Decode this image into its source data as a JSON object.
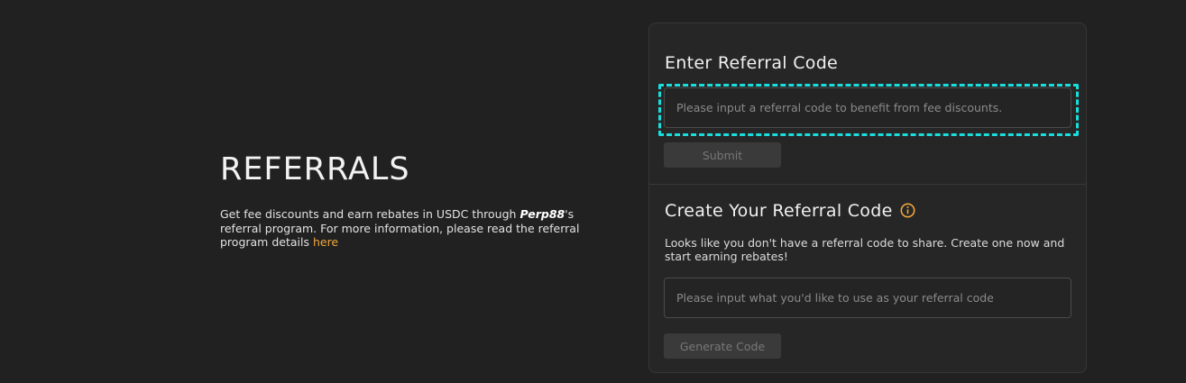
{
  "intro": {
    "title": "REFERRALS",
    "text_before": "Get fee discounts and earn rebates in USDC through ",
    "brand": "Perp88",
    "text_after": "'s referral program. For more information, please read the referral program details ",
    "link_label": "here"
  },
  "enter_section": {
    "title": "Enter Referral Code",
    "input_placeholder": "Please input a referral code to benefit from fee discounts.",
    "input_value": "",
    "submit_label": "Submit"
  },
  "create_section": {
    "title": "Create Your Referral Code",
    "info_icon": "info-circle-icon",
    "description": "Looks like you don't have a referral code to share. Create one now and start earning rebates!",
    "input_placeholder": "Please input what you'd like to use as your referral code",
    "input_value": "",
    "generate_label": "Generate Code"
  },
  "colors": {
    "background": "#212121",
    "card": "#262626",
    "accent": "#f0a53a",
    "highlight": "#19dede",
    "button_disabled": "#3a3a3a"
  }
}
